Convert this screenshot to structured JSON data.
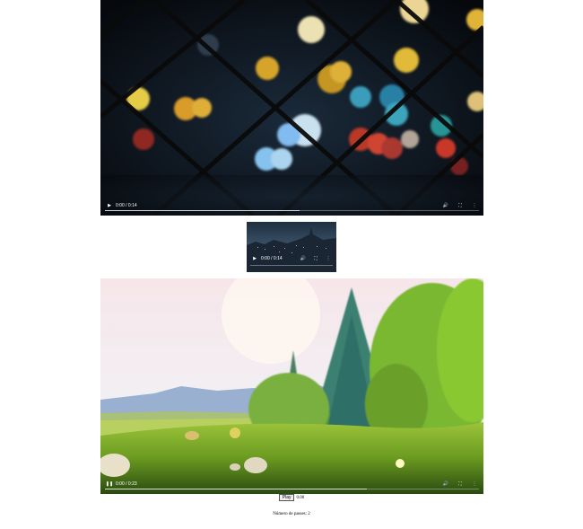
{
  "videos": [
    {
      "time": "0:00 / 0:14",
      "progress": 0.52
    },
    {
      "time": "0:00 / 0:14",
      "progress": 0.0
    },
    {
      "time": "0:00 / 0:23",
      "progress": 0.7
    }
  ],
  "playback": {
    "button_label": "Play",
    "time": "0.00"
  },
  "footer": {
    "passes": "Número de passes: 2"
  },
  "icons": [
    "play-icon",
    "pause-icon",
    "volume-icon",
    "fullscreen-icon",
    "more-options-icon"
  ]
}
